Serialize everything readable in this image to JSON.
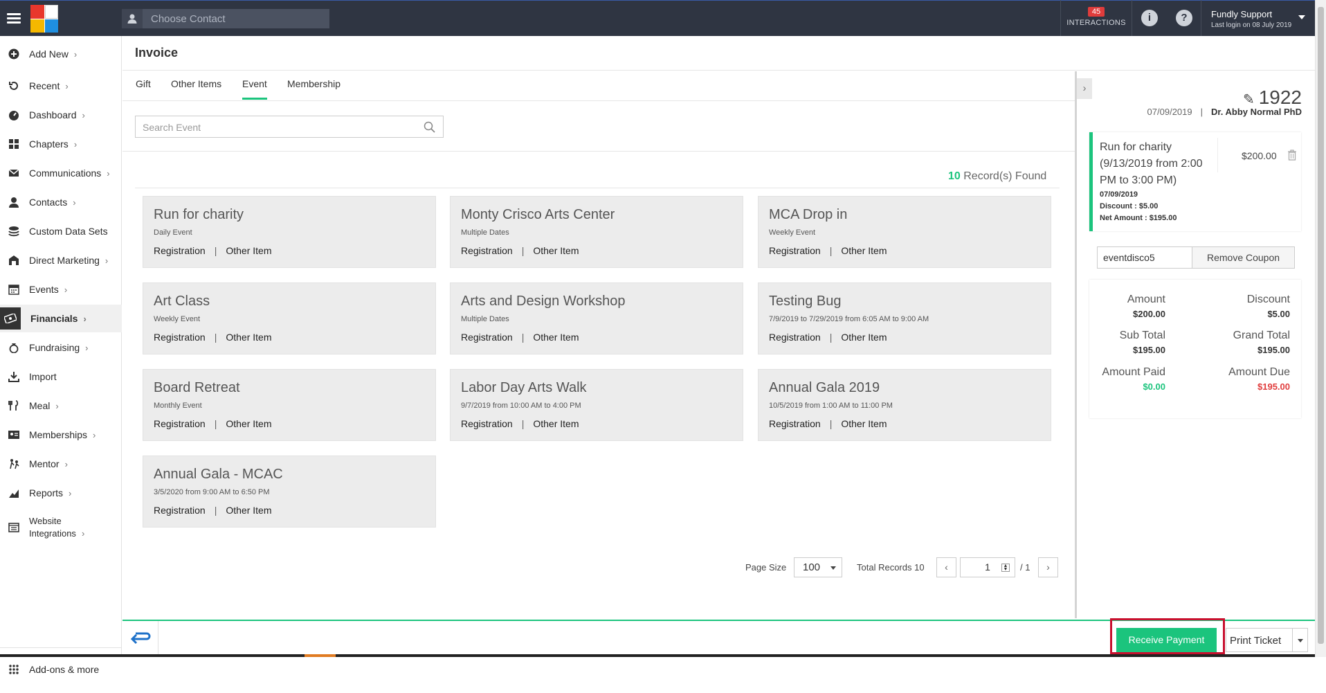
{
  "header": {
    "contact_placeholder": "Choose Contact",
    "interactions_count": "45",
    "interactions_label": "INTERACTIONS",
    "user_name": "Fundly Support",
    "last_login": "Last login on 08 July 2019"
  },
  "sidebar": {
    "items": [
      {
        "label": "Add New",
        "icon": "plus-circle-icon"
      },
      {
        "label": "Recent",
        "icon": "history-icon"
      },
      {
        "label": "Dashboard",
        "icon": "dashboard-icon"
      },
      {
        "label": "Chapters",
        "icon": "grid-icon"
      },
      {
        "label": "Communications",
        "icon": "envelope-icon"
      },
      {
        "label": "Contacts",
        "icon": "person-icon"
      },
      {
        "label": "Custom Data Sets",
        "icon": "stack-icon"
      },
      {
        "label": "Direct Marketing",
        "icon": "building-icon"
      },
      {
        "label": "Events",
        "icon": "calendar-icon"
      },
      {
        "label": "Financials",
        "icon": "money-icon"
      },
      {
        "label": "Fundraising",
        "icon": "moneybag-icon"
      },
      {
        "label": "Import",
        "icon": "import-icon"
      },
      {
        "label": "Meal",
        "icon": "cutlery-icon"
      },
      {
        "label": "Memberships",
        "icon": "idcard-icon"
      },
      {
        "label": "Mentor",
        "icon": "mentor-icon"
      },
      {
        "label": "Reports",
        "icon": "chart-icon"
      },
      {
        "label": "Website",
        "label2": "Integrations",
        "icon": "website-icon"
      }
    ],
    "addons": "Add-ons & more"
  },
  "page": {
    "title": "Invoice",
    "tabs": [
      "Gift",
      "Other Items",
      "Event",
      "Membership"
    ],
    "active_tab": "Event",
    "search_placeholder": "Search Event",
    "records_count": "10",
    "records_label": " Record(s) Found"
  },
  "events": [
    {
      "title": "Run for charity",
      "sub": "Daily Event",
      "a1": "Registration",
      "a2": "Other Item"
    },
    {
      "title": "Monty Crisco Arts Center",
      "sub": "Multiple Dates",
      "a1": "Registration",
      "a2": "Other Item"
    },
    {
      "title": "MCA Drop in",
      "sub": "Weekly Event",
      "a1": "Registration",
      "a2": "Other Item"
    },
    {
      "title": "Art Class",
      "sub": "Weekly Event",
      "a1": "Registration",
      "a2": "Other Item"
    },
    {
      "title": "Arts and Design Workshop",
      "sub": "Multiple Dates",
      "a1": "Registration",
      "a2": "Other Item"
    },
    {
      "title": "Testing Bug",
      "sub": "7/9/2019 to 7/29/2019 from 6:05 AM to 9:00 AM",
      "a1": "Registration",
      "a2": "Other Item"
    },
    {
      "title": "Board Retreat",
      "sub": "Monthly Event",
      "a1": "Registration",
      "a2": "Other Item"
    },
    {
      "title": "Labor Day Arts Walk",
      "sub": "9/7/2019 from 10:00 AM to 4:00 PM",
      "a1": "Registration",
      "a2": "Other Item"
    },
    {
      "title": "Annual Gala 2019",
      "sub": "10/5/2019 from 1:00 AM to 11:00 PM",
      "a1": "Registration",
      "a2": "Other Item"
    },
    {
      "title": "Annual Gala - MCAC",
      "sub": "3/5/2020 from 9:00 AM to 6:50 PM",
      "a1": "Registration",
      "a2": "Other Item"
    }
  ],
  "pager": {
    "page_size_label": "Page Size",
    "page_size": "100",
    "total_records": "Total Records 10",
    "prev": "‹",
    "next": "›",
    "current_page": "1",
    "of_pages": "/ 1"
  },
  "invoice": {
    "number": "1922",
    "date": "07/09/2019",
    "separator": "|",
    "contact": "Dr. Abby Normal PhD",
    "item": {
      "title": "Run for charity (9/13/2019 from 2:00 PM to 3:00 PM)",
      "date": "07/09/2019",
      "discount": "Discount : $5.00",
      "net": "Net Amount : $195.00",
      "amount": "$200.00"
    },
    "coupon_code": "eventdisco5",
    "remove_coupon": "Remove Coupon",
    "totals": {
      "amount_label": "Amount",
      "amount": "$200.00",
      "discount_label": "Discount",
      "discount": "$5.00",
      "subtotal_label": "Sub Total",
      "subtotal": "$195.00",
      "grand_label": "Grand Total",
      "grand": "$195.00",
      "paid_label": "Amount Paid",
      "paid": "$0.00",
      "due_label": "Amount Due",
      "due": "$195.00"
    }
  },
  "footer": {
    "receive_payment": "Receive Payment",
    "print_ticket": "Print Ticket"
  },
  "colors": {
    "accent": "#1bc47d",
    "topbar": "#2f3542",
    "due": "#e03c3c",
    "highlight": "#c8102e"
  }
}
